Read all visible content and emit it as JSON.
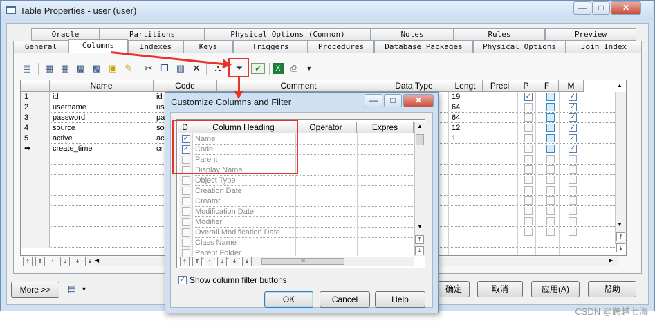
{
  "window": {
    "title": "Table Properties - user (user)",
    "min_label": "—",
    "max_label": "□",
    "close_label": "✕"
  },
  "tabs_row1": [
    "Oracle",
    "Partitions",
    "Physical Options (Common)",
    "Notes",
    "Rules",
    "Preview"
  ],
  "tabs_row2": [
    "General",
    "Columns",
    "Indexes",
    "Keys",
    "Triggers",
    "Procedures",
    "Database Packages",
    "Physical Options",
    "Join Index"
  ],
  "active_tab": "Columns",
  "grid": {
    "headers": [
      "Name",
      "Code",
      "Comment",
      "Data Type",
      "Lengt",
      "Preci",
      "P",
      "F",
      "M"
    ],
    "rows": [
      {
        "num": "1",
        "name": "id",
        "code": "id",
        "length": "19"
      },
      {
        "num": "2",
        "name": "username",
        "code": "us",
        "length": "64"
      },
      {
        "num": "3",
        "name": "password",
        "code": "pa",
        "length": "64"
      },
      {
        "num": "4",
        "name": "source",
        "code": "so",
        "length": "12"
      },
      {
        "num": "5",
        "name": "active",
        "code": "ac",
        "length": "1"
      },
      {
        "num": "➡",
        "name": "create_time",
        "code": "cr",
        "length": ""
      }
    ],
    "p_checked": [
      true,
      false,
      false,
      false,
      false,
      false
    ],
    "m_checked": [
      true,
      true,
      true,
      true,
      true,
      true
    ]
  },
  "nav_buttons": [
    "⤒",
    "⇑",
    "↑",
    "↓",
    "⇓",
    "⤓"
  ],
  "bottom": {
    "more_label": "More >>",
    "ok_label": "确定",
    "cancel_label": "取消",
    "apply_label": "应用(A)",
    "help_label": "帮助"
  },
  "dialog": {
    "title": "Customize Columns and Filter",
    "headers": [
      "D",
      "Column Heading",
      "Operator",
      "Expres"
    ],
    "items": [
      {
        "label": "Name",
        "checked": true
      },
      {
        "label": "Code",
        "checked": true
      },
      {
        "label": "Parent",
        "checked": false
      },
      {
        "label": "Display Name",
        "checked": false
      },
      {
        "label": "Object Type",
        "checked": false
      },
      {
        "label": "Creation Date",
        "checked": false
      },
      {
        "label": "Creator",
        "checked": false
      },
      {
        "label": "Modification Date",
        "checked": false
      },
      {
        "label": "Modifier",
        "checked": false
      },
      {
        "label": "Overall Modification Date",
        "checked": false
      },
      {
        "label": "Class Name",
        "checked": false
      },
      {
        "label": "Parent Folder",
        "checked": false
      }
    ],
    "show_filter_label": "Show column filter buttons",
    "show_filter_checked": true,
    "hscroll_label": "III",
    "ok_label": "OK",
    "cancel_label": "Cancel",
    "help_label": "Help"
  },
  "watermark": "CSDN @跨越七海",
  "accent_color": "#e8332b"
}
